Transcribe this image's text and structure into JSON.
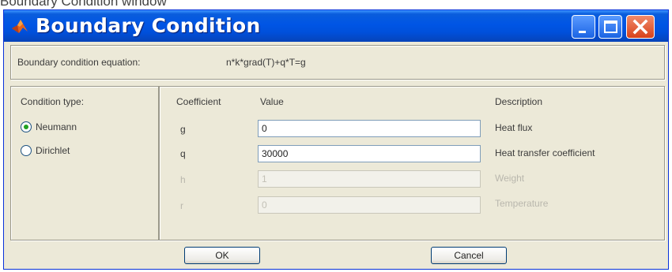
{
  "window": {
    "caption_above": "Boundary Condition window",
    "title": "Boundary Condition",
    "minimize_icon": "minimize-icon",
    "maximize_icon": "maximize-icon",
    "close_icon": "close-icon"
  },
  "equation": {
    "label": "Boundary condition equation:",
    "value": "n*k*grad(T)+q*T=g"
  },
  "condition": {
    "label": "Condition type:",
    "options": [
      {
        "label": "Neumann",
        "selected": true
      },
      {
        "label": "Dirichlet",
        "selected": false
      }
    ]
  },
  "table": {
    "headers": {
      "coefficient": "Coefficient",
      "value": "Value",
      "description": "Description"
    },
    "rows": [
      {
        "coefficient": "g",
        "value": "0",
        "description": "Heat flux",
        "enabled": true
      },
      {
        "coefficient": "q",
        "value": "30000",
        "description": "Heat transfer coefficient",
        "enabled": true
      },
      {
        "coefficient": "h",
        "value": "1",
        "description": "Weight",
        "enabled": false
      },
      {
        "coefficient": "r",
        "value": "0",
        "description": "Temperature",
        "enabled": false
      }
    ]
  },
  "buttons": {
    "ok": "OK",
    "cancel": "Cancel"
  },
  "colors": {
    "title_bar": "#0055e5",
    "dialog_bg": "#ece9d8",
    "close_button": "#d8421c",
    "radio_dot": "#21a121"
  }
}
